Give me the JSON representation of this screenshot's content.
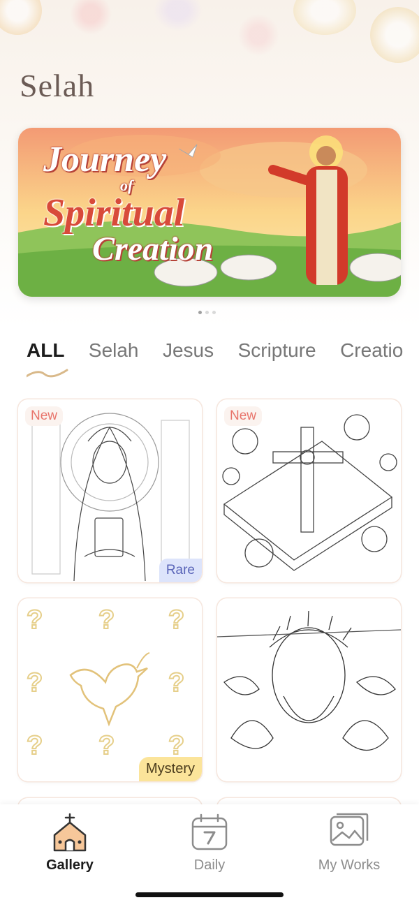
{
  "app": {
    "logo": "Selah"
  },
  "banner": {
    "line1": "Journey",
    "line2": "of",
    "line3": "Spiritual",
    "line4": "Creation",
    "dots": 3,
    "active_dot": 0
  },
  "categories": [
    "ALL",
    "Selah",
    "Jesus",
    "Scripture",
    "Creatio"
  ],
  "cards": [
    {
      "badge_new": "New",
      "badge_corner": "Rare"
    },
    {
      "badge_new": "New"
    },
    {
      "badge_corner": "Mystery"
    },
    {}
  ],
  "nav": {
    "gallery": "Gallery",
    "daily": "Daily",
    "my_works": "My Works",
    "active": "gallery"
  },
  "colors": {
    "accent": "#c9a25b",
    "new_badge": "#e8746b",
    "rare_badge": "#5964b8",
    "mystery_badge": "#fbe49a"
  }
}
